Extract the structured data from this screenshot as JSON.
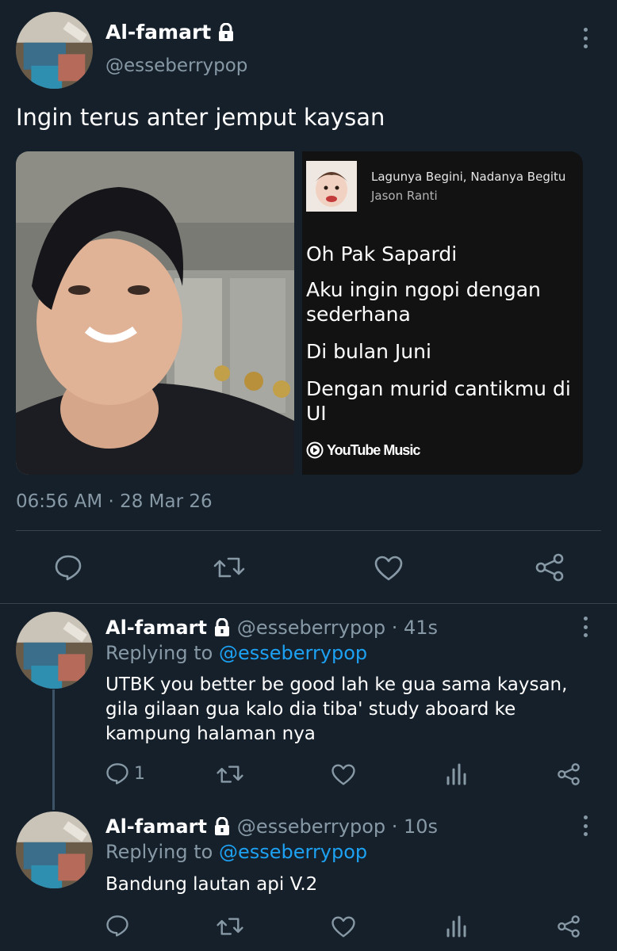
{
  "main_tweet": {
    "author_name": "Al-famart",
    "handle": "@esseberrypop",
    "text": "Ingin terus anter jemput kaysan",
    "timestamp": "06:56 AM · 28 Mar 26"
  },
  "song_card": {
    "song_title": "Lagunya Begini, Nadanya Begitu",
    "artist": "Jason Ranti",
    "lyrics": [
      "Oh Pak Sapardi",
      "Aku ingin ngopi dengan sederhana",
      "Di bulan Juni",
      "Dengan murid cantikmu di UI"
    ],
    "brand": "YouTube Music"
  },
  "replies": [
    {
      "author_name": "Al-famart",
      "handle_time": "@esseberrypop · 41s",
      "replying_prefix": "Replying to",
      "replying_handle": "@esseberrypop",
      "text": "UTBK you better be good lah ke gua sama kaysan, gila gilaan gua kalo dia tiba' study aboard ke kampung halaman nya",
      "reply_count": "1"
    },
    {
      "author_name": "Al-famart",
      "handle_time": "@esseberrypop · 10s",
      "replying_prefix": "Replying to",
      "replying_handle": "@esseberrypop",
      "text": "Bandung lautan api V.2",
      "reply_count": ""
    }
  ],
  "icons": [
    "lock-icon",
    "more-icon",
    "reply-icon",
    "retweet-icon",
    "like-icon",
    "share-icon",
    "analytics-icon",
    "youtube-music-icon"
  ],
  "colors": {
    "background": "#15202b",
    "accent": "#1da1f2",
    "muted": "#8899a6",
    "divider": "#38444d"
  }
}
